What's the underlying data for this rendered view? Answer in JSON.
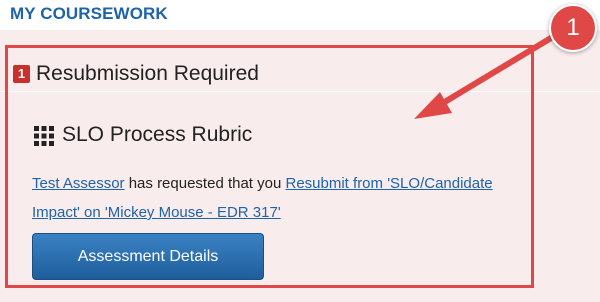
{
  "header": {
    "title": "MY COURSEWORK"
  },
  "panel": {
    "badge_count": "1",
    "title": "Resubmission Required"
  },
  "item": {
    "icon": "rubric-grid-icon",
    "title": "SLO Process Rubric",
    "requester_link": "Test Assessor",
    "message_middle": " has requested that you ",
    "resubmit_link": "Resubmit from 'SLO/Candidate Impact' on 'Mickey Mouse - EDR 317'",
    "button_label": "Assessment Details"
  },
  "annotation": {
    "callout_number": "1"
  },
  "colors": {
    "link": "#1f63a8",
    "card_background": "#f9ecec",
    "highlight": "#e04848",
    "badge": "#c9302c",
    "button": "#2a6fb0"
  }
}
